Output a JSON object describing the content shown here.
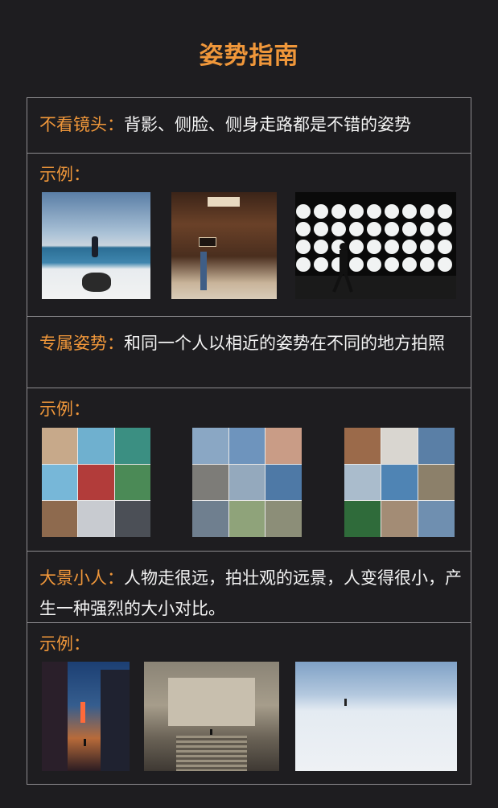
{
  "title": "姿势指南",
  "sections": [
    {
      "key": "不看镜头：",
      "desc": "背影、侧脸、侧身走路都是不错的姿势",
      "example_label": "示例：",
      "images": [
        "seaside-back-view-photo",
        "japanese-shop-front-photo",
        "white-circles-wall-walker-photo"
      ]
    },
    {
      "key": "专属姿势：",
      "desc": "和同一个人以相近的姿势在不同的地方拍照",
      "example_label": "示例：",
      "images": [
        "travel-collage-woman-photo",
        "travel-collage-family-photo",
        "travel-collage-elderly-couple-photo"
      ]
    },
    {
      "key": "大景小人：",
      "desc": "人物走很远，拍壮观的远景，人变得很小，产生一种强烈的大小对比。",
      "example_label": "示例：",
      "images": [
        "night-street-tiny-person-photo",
        "grand-staircase-hall-photo",
        "salt-flat-tiny-person-photo"
      ]
    }
  ]
}
